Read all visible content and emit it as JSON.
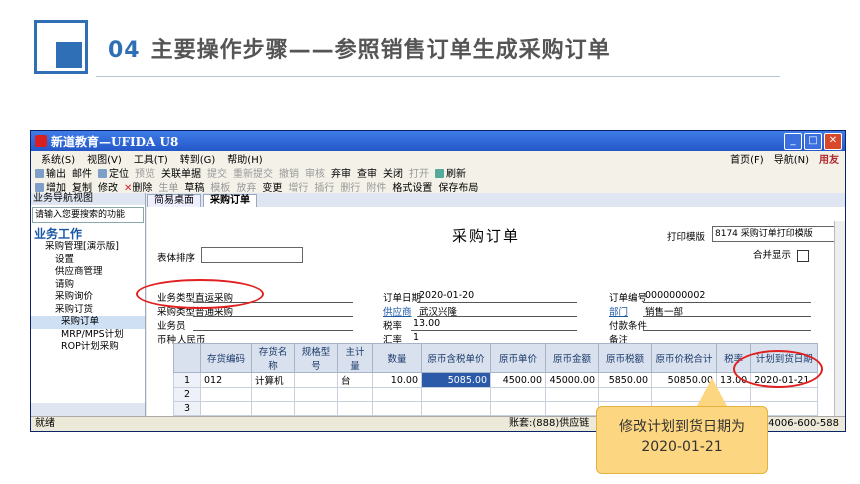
{
  "slide": {
    "number": "04",
    "title": "主要操作步骤——参照销售订单生成采购订单"
  },
  "window": {
    "title": "新道教育—UFIDA U8"
  },
  "menubar": {
    "items": [
      "系统(S)",
      "视图(V)",
      "工具(T)",
      "转到(G)",
      "帮助(H)"
    ],
    "right": [
      "首页(F)",
      "导航(N)"
    ],
    "brand": "用友"
  },
  "toolbar1": [
    "输出",
    "邮件",
    "定位",
    "预览",
    "关联单据",
    "提交",
    "重新提交",
    "撤销",
    "审核",
    "弃审",
    "查审",
    "关闭",
    "打开",
    "刷新"
  ],
  "toolbar2": [
    "增加",
    "复制",
    "修改",
    "删除",
    "生单",
    "草稿",
    "模板",
    "放弃",
    "变更",
    "增行",
    "插行",
    "删行",
    "附件",
    "格式设置",
    "保存布局"
  ],
  "nav": {
    "header": "业务导航视图",
    "search_placeholder": "请输入您要搜索的功能",
    "section": "业务工作",
    "items": [
      "采购管理[演示版]",
      "设置",
      "供应商管理",
      "请购",
      "采购询价",
      "采购订货",
      "采购订单",
      "MRP/MPS计划",
      "ROP计划采购"
    ]
  },
  "tabs": [
    "简易桌面",
    "采购订单"
  ],
  "form": {
    "title": "采购订单",
    "print_label": "打印模版",
    "print_value": "8174 采购订单打印模版",
    "sort_label": "表体排序",
    "merge_label": "合并显示",
    "fields": {
      "biz_type_label": "业务类型",
      "biz_type": "直运采购",
      "order_date_label": "订单日期",
      "order_date": "2020-01-20",
      "order_no_label": "订单编号",
      "order_no": "0000000002",
      "purchase_type_label": "采购类型",
      "purchase_type": "普通采购",
      "supplier_label": "供应商",
      "supplier": "武汉兴隆",
      "dept_label": "部门",
      "dept": "销售一部",
      "clerk_label": "业务员",
      "tax_rate_label": "税率",
      "tax_rate": "13.00",
      "pay_cond_label": "付款条件",
      "currency_label": "币种",
      "currency": "人民币",
      "exch_rate_label": "汇率",
      "exch_rate": "1",
      "note_label": "备注"
    },
    "columns": [
      "存货编码",
      "存货名称",
      "规格型号",
      "主计量",
      "数量",
      "原币含税单价",
      "原币单价",
      "原币金额",
      "原币税额",
      "原币价税合计",
      "税率",
      "计划到货日期"
    ],
    "rows": [
      {
        "n": "1",
        "cells": [
          "012",
          "计算机",
          "",
          "台",
          "10.00",
          "5085.00",
          "4500.00",
          "45000.00",
          "5850.00",
          "50850.00",
          "13.00",
          "2020-01-21"
        ]
      },
      {
        "n": "2",
        "cells": [
          "",
          "",
          "",
          "",
          "",
          "",
          "",
          "",
          "",
          "",
          "",
          ""
        ]
      },
      {
        "n": "3",
        "cells": [
          "",
          "",
          "",
          "",
          "",
          "",
          "",
          "",
          "",
          "",
          "",
          ""
        ]
      }
    ]
  },
  "status": {
    "left": "就绪",
    "mid": "账套:(888)供应链",
    "right": "4006-600-588"
  },
  "callout": {
    "line1": "修改计划到货日期为",
    "line2": "2020-01-21"
  }
}
